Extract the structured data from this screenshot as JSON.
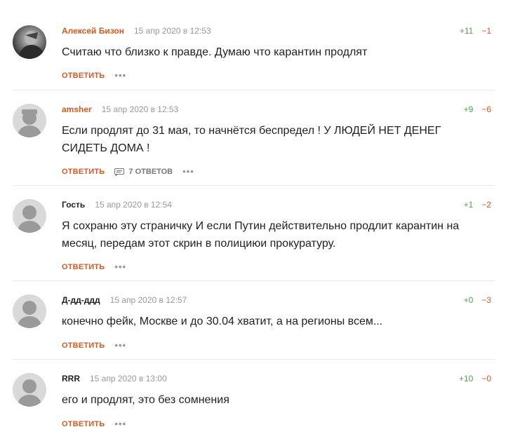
{
  "comments": [
    {
      "author": "Алексей Бизон",
      "date": "15 апр 2020 в 12:53",
      "plus": "+11",
      "minus": "−1",
      "text": "Считаю что близко к правде. Думаю что карантин продлят",
      "reply_label": "ОТВЕТИТЬ",
      "more": "•••"
    },
    {
      "author": "amsher",
      "date": "15 апр 2020 в 12:53",
      "plus": "+9",
      "minus": "−6",
      "text": "Если продлят до 31 мая, то начнётся беспредел ! У ЛЮДЕЙ НЕТ ДЕНЕГ СИДЕТЬ ДОМА !",
      "reply_label": "ОТВЕТИТЬ",
      "answers_label": "7 ОТВЕТОВ",
      "more": "•••"
    },
    {
      "author": "Гость",
      "date": "15 апр 2020 в 12:54",
      "plus": "+1",
      "minus": "−2",
      "text": "Я сохраню эту страничку И если Путин действительно продлит карантин на месяц, передам этот скрин в полициюи прокуратуру.",
      "reply_label": "ОТВЕТИТЬ",
      "more": "•••"
    },
    {
      "author": "Д-дд-ддд",
      "date": "15 апр 2020 в 12:57",
      "plus": "+0",
      "minus": "−3",
      "text": "конечно фейк, Москве и до 30.04 хватит, а на регионы всем...",
      "reply_label": "ОТВЕТИТЬ",
      "more": "•••"
    },
    {
      "author": "RRR",
      "date": "15 апр 2020 в 13:00",
      "plus": "+10",
      "minus": "−0",
      "text": "его и продлят, это без сомнения",
      "reply_label": "ОТВЕТИТЬ",
      "more": "•••"
    }
  ],
  "colors": {
    "accent": "#e2571e",
    "positive": "#4aa54a",
    "muted": "#999999"
  },
  "icons": {
    "answers": "speech-bubble-icon",
    "avatar_default": "user-silhouette-icon"
  }
}
